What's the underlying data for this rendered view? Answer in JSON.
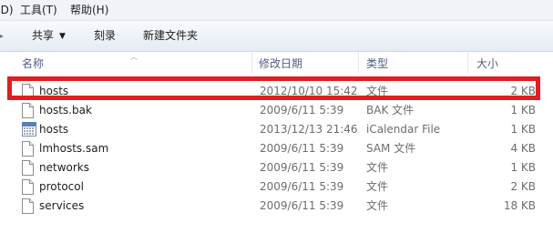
{
  "menu": {
    "items": [
      {
        "label": "(D)"
      },
      {
        "label": "工具(T)"
      },
      {
        "label": "帮助(H)"
      }
    ]
  },
  "toolbar": {
    "share_label": "共享",
    "burn_label": "刻录",
    "new_folder_label": "新建文件夹"
  },
  "columns": {
    "name": "名称",
    "date": "修改日期",
    "type": "类型",
    "size": "大小"
  },
  "files": [
    {
      "name": "hosts",
      "date": "2012/10/10 15:42",
      "type": "文件",
      "size": "2 KB",
      "icon": "file-icon"
    },
    {
      "name": "hosts.bak",
      "date": "2009/6/11 5:39",
      "type": "BAK 文件",
      "size": "1 KB",
      "icon": "file-icon"
    },
    {
      "name": "hosts",
      "date": "2013/12/13 21:46",
      "type": "iCalendar File",
      "size": "1 KB",
      "icon": "calendar-icon"
    },
    {
      "name": "lmhosts.sam",
      "date": "2009/6/11 5:39",
      "type": "SAM 文件",
      "size": "4 KB",
      "icon": "file-icon"
    },
    {
      "name": "networks",
      "date": "2009/6/11 5:39",
      "type": "文件",
      "size": "1 KB",
      "icon": "file-icon"
    },
    {
      "name": "protocol",
      "date": "2009/6/11 5:39",
      "type": "文件",
      "size": "2 KB",
      "icon": "file-icon"
    },
    {
      "name": "services",
      "date": "2009/6/11 5:39",
      "type": "文件",
      "size": "18 KB",
      "icon": "file-icon"
    }
  ],
  "colors": {
    "highlight": "#e01d22",
    "header_text": "#4d6185"
  }
}
